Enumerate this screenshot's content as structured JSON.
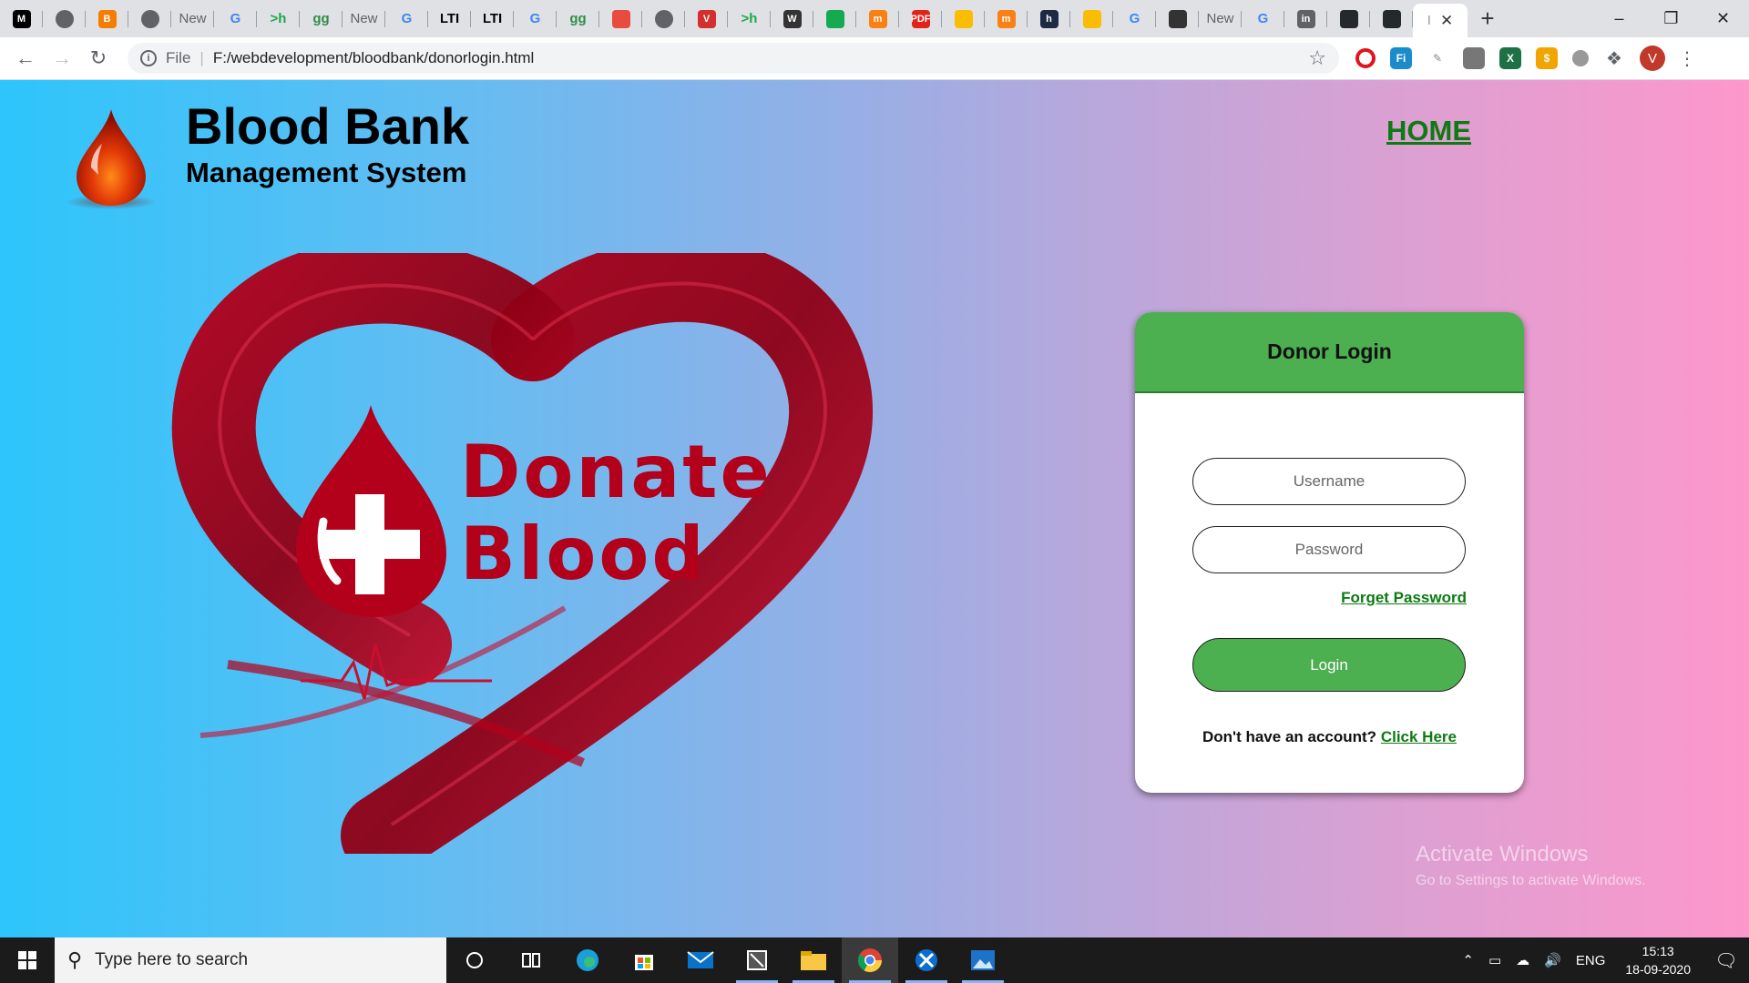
{
  "browser": {
    "tabs": [
      {
        "icon": "medium-icon",
        "label": "M",
        "color": "#000000"
      },
      {
        "icon": "globe-icon",
        "label": "",
        "color": "#5f6368"
      },
      {
        "icon": "blogger-icon",
        "label": "B",
        "color": "#f57d00"
      },
      {
        "icon": "globe-icon",
        "label": "",
        "color": "#5f6368"
      },
      {
        "icon": "newtab-icon",
        "label": "New",
        "color": ""
      },
      {
        "icon": "google-icon",
        "label": "G",
        "color": "#4285f4"
      },
      {
        "icon": "hackerrank-icon",
        "label": ">h",
        "color": "#1ba94c"
      },
      {
        "icon": "geeksforgeeks-icon",
        "label": "gg",
        "color": "#2f8d46"
      },
      {
        "icon": "newtab-icon",
        "label": "New",
        "color": ""
      },
      {
        "icon": "google-icon",
        "label": "G",
        "color": "#4285f4"
      },
      {
        "icon": "lti-icon",
        "label": "LTI",
        "color": "#000000"
      },
      {
        "icon": "lti-icon",
        "label": "LTI",
        "color": "#000000"
      },
      {
        "icon": "google-icon",
        "label": "G",
        "color": "#4285f4"
      },
      {
        "icon": "geeksforgeeks-icon",
        "label": "gg",
        "color": "#2f8d46"
      },
      {
        "icon": "book-icon",
        "label": "",
        "color": "#e74c3c"
      },
      {
        "icon": "globe-icon",
        "label": "",
        "color": "#5f6368"
      },
      {
        "icon": "vivaldi-icon",
        "label": "V",
        "color": "#d32f2f"
      },
      {
        "icon": "hackerrank-icon",
        "label": ">h",
        "color": "#1ba94c"
      },
      {
        "icon": "wordpress-icon",
        "label": "W",
        "color": "#333333"
      },
      {
        "icon": "leaf-icon",
        "label": "",
        "color": "#13aa52"
      },
      {
        "icon": "moodle-icon",
        "label": "m",
        "color": "#f98012"
      },
      {
        "icon": "pdf-icon",
        "label": "PDF",
        "color": "#e2231a"
      },
      {
        "icon": "drive-icon",
        "label": "",
        "color": "#fbbc04"
      },
      {
        "icon": "moodle-icon",
        "label": "m",
        "color": "#f98012"
      },
      {
        "icon": "hashnode-icon",
        "label": "h",
        "color": "#1e2a44"
      },
      {
        "icon": "pinwheel-icon",
        "label": "",
        "color": "#fbbc04"
      },
      {
        "icon": "google-icon",
        "label": "G",
        "color": "#4285f4"
      },
      {
        "icon": "quill-icon",
        "label": "",
        "color": "#333333"
      },
      {
        "icon": "newtab-icon",
        "label": "New",
        "color": ""
      },
      {
        "icon": "google-icon",
        "label": "G",
        "color": "#4285f4"
      },
      {
        "icon": "linkedin-icon",
        "label": "in",
        "color": "#5f6368"
      },
      {
        "icon": "github-icon",
        "label": "",
        "color": "#24292e"
      },
      {
        "icon": "github-icon",
        "label": "",
        "color": "#24292e"
      }
    ],
    "active_tab_label": "I",
    "address": {
      "scheme": "File",
      "url": "F:/webdevelopment/bloodbank/donorlogin.html"
    },
    "profile_initial": "V"
  },
  "site": {
    "title": "Blood Bank",
    "subtitle": "Management System",
    "nav_home": "HOME",
    "hero_text_1": "Donate",
    "hero_text_2": "Blood"
  },
  "login": {
    "header": "Donor Login",
    "username_placeholder": "Username",
    "password_placeholder": "Password",
    "forget": "Forget Password",
    "button": "Login",
    "signup_prompt": "Don't have an account?",
    "signup_link": "Click Here"
  },
  "watermark": {
    "line1": "Activate Windows",
    "line2": "Go to Settings to activate Windows."
  },
  "taskbar": {
    "search_placeholder": "Type here to search",
    "language": "ENG",
    "time": "15:13",
    "date": "18-09-2020"
  },
  "colors": {
    "accent_green": "#4caf50",
    "link_green": "#0d7a12",
    "blood_red": "#c0121f",
    "gradient_left": "#2dc5fb",
    "gradient_right": "#fd97cc"
  }
}
